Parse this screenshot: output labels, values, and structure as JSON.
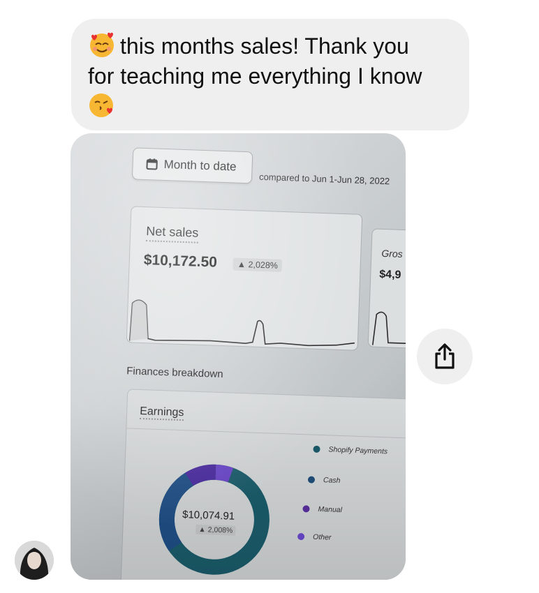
{
  "message": {
    "text_line1": "this months sales! Thank you",
    "text_line2": "for teaching me everything I know",
    "leading_emoji": "smiling-face-with-hearts",
    "trailing_emoji": "face-blowing-a-kiss"
  },
  "photo": {
    "date_button_label": "Month to date",
    "compared_text": "compared to Jun 1-Jun 28, 2022",
    "net_sales_title": "Net sales",
    "net_sales_value": "$10,172.50",
    "net_sales_change": "▲ 2,028%",
    "gross_title_partial": "Gros",
    "gross_value_partial": "$4,9",
    "finances_title": "Finances breakdown",
    "earnings_title": "Earnings",
    "donut_total": "$10,074.91",
    "donut_change": "▲ 2,008%",
    "legend": [
      {
        "label": "Shopify Payments",
        "color": "#1a5a6a"
      },
      {
        "label": "Cash",
        "color": "#1f4f7a"
      },
      {
        "label": "Manual",
        "color": "#5a2fa0"
      },
      {
        "label": "Other",
        "color": "#6b4bd0"
      }
    ]
  },
  "share_button": {
    "icon": "share-icon"
  },
  "avatar": {
    "icon": "user-avatar"
  }
}
